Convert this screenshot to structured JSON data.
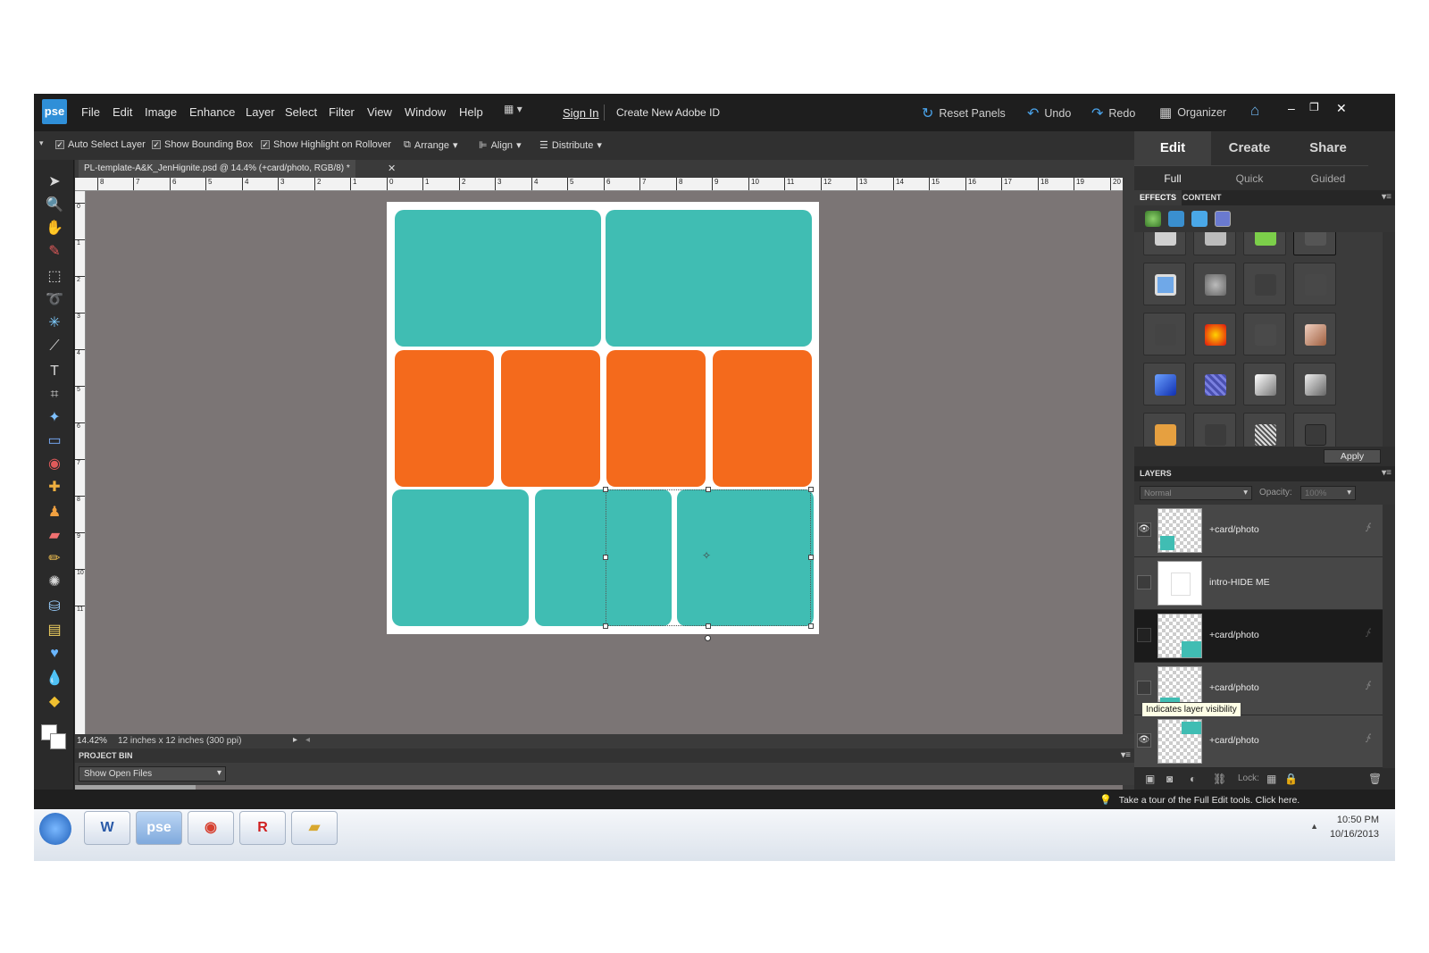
{
  "app": {
    "logo": "pse"
  },
  "menu": [
    "File",
    "Edit",
    "Image",
    "Enhance",
    "Layer",
    "Select",
    "Filter",
    "View",
    "Window",
    "Help"
  ],
  "account": {
    "sign_in": "Sign In",
    "create_id": "Create New Adobe ID"
  },
  "top_actions": {
    "reset_panels": "Reset Panels",
    "undo": "Undo",
    "redo": "Redo",
    "organizer": "Organizer"
  },
  "options_bar": {
    "auto_select": "Auto Select Layer",
    "bounding_box": "Show Bounding Box",
    "highlight": "Show Highlight on Rollover",
    "arrange": "Arrange",
    "align": "Align",
    "distribute": "Distribute"
  },
  "document": {
    "tab_title": "PL-template-A&K_JenHignite.psd @ 14.4% (+card/photo, RGB/8) *",
    "zoom": "14.42%",
    "size_info": "12 inches x 12 inches (300 ppi)"
  },
  "ruler_h": [
    "8",
    "7",
    "6",
    "5",
    "4",
    "3",
    "2",
    "1",
    "0",
    "1",
    "2",
    "3",
    "4",
    "5",
    "6",
    "7",
    "8",
    "9",
    "10",
    "11",
    "12",
    "13",
    "14",
    "15",
    "16",
    "17",
    "18",
    "19",
    "20"
  ],
  "ruler_v": [
    "0",
    "1",
    "2",
    "3",
    "4",
    "5",
    "6",
    "7",
    "8",
    "9",
    "10",
    "11"
  ],
  "project_bin": {
    "title": "PROJECT BIN",
    "select": "Show Open Files"
  },
  "mode_tabs": [
    "Edit",
    "Create",
    "Share"
  ],
  "sub_tabs": [
    "Full",
    "Quick",
    "Guided"
  ],
  "effects_tabs": [
    "EFFECTS",
    "CONTENT"
  ],
  "apply": "Apply",
  "layers": {
    "title": "LAYERS",
    "blend_mode": "Normal",
    "opacity_label": "Opacity:",
    "opacity_value": "100%",
    "rows": [
      {
        "name": "+card/photo",
        "visible": true
      },
      {
        "name": "intro-HIDE ME",
        "visible": false
      },
      {
        "name": "+card/photo",
        "visible": false,
        "selected": true
      },
      {
        "name": "+card/photo",
        "visible": false
      },
      {
        "name": "+card/photo",
        "visible": true
      }
    ],
    "tooltip": "Indicates layer visibility",
    "lock_label": "Lock:"
  },
  "status_tip": "Take a tour of the Full Edit tools. Click here.",
  "clock": {
    "time": "10:50 PM",
    "date": "10/16/2013"
  },
  "colors": {
    "teal": "#40bdb3",
    "orange": "#f46a1c",
    "canvas_bg": "#7b7575"
  }
}
